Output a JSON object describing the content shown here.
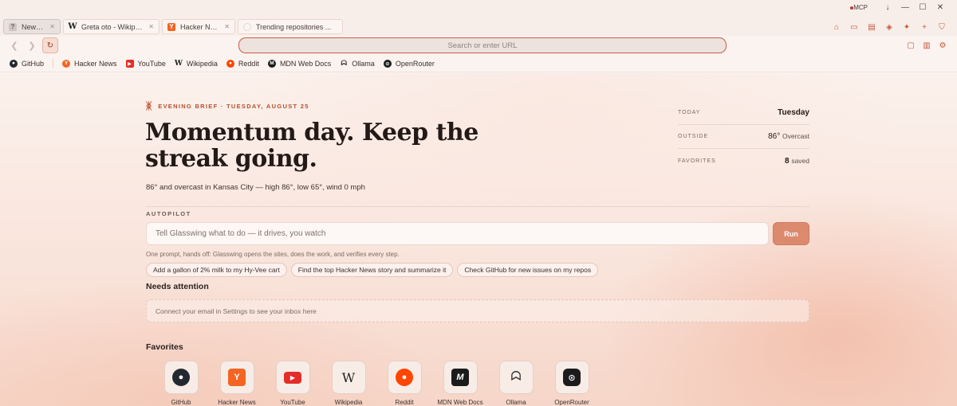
{
  "tabs": [
    {
      "title": "New Tab",
      "icon": "new-tab-icon",
      "active": true
    },
    {
      "title": "Greta oto - Wikipedia",
      "icon": "wikipedia-icon",
      "active": false
    },
    {
      "title": "Hacker News",
      "icon": "hacker-news-icon",
      "active": false
    },
    {
      "title": "Trending repositories ...",
      "icon": "github-icon",
      "active": false
    }
  ],
  "window": {
    "mcp_label": "MCP",
    "mcp_color": "#c0392b"
  },
  "urlbar": {
    "placeholder": "Search or enter URL"
  },
  "bookmarks": [
    {
      "label": "GitHub",
      "icon": "github-icon",
      "color": "#24292f"
    },
    {
      "label": "Hacker News",
      "icon": "hacker-news-icon",
      "color": "#f26522"
    },
    {
      "label": "YouTube",
      "icon": "youtube-icon",
      "color": "#e52d27"
    },
    {
      "label": "Wikipedia",
      "icon": "wikipedia-icon",
      "color": "#333333"
    },
    {
      "label": "Reddit",
      "icon": "reddit-icon",
      "color": "#ff4500"
    },
    {
      "label": "MDN Web Docs",
      "icon": "mdn-icon",
      "color": "#1b1b1b"
    },
    {
      "label": "Ollama",
      "icon": "ollama-icon",
      "color": "#333333"
    },
    {
      "label": "OpenRouter",
      "icon": "openrouter-icon",
      "color": "#1b1b1b"
    }
  ],
  "brief": {
    "label": "EVENING BRIEF · TUESDAY, AUGUST 25",
    "headline": "Momentum day. Keep the streak going.",
    "weather": "86° and overcast in Kansas City — high 86°, low 65°, wind 0 mph"
  },
  "stats": {
    "today_label": "TODAY",
    "today_value": "Tuesday",
    "outside_label": "OUTSIDE",
    "outside_temp": "86°",
    "outside_cond": "Overcast",
    "favorites_label": "FAVORITES",
    "favorites_count": "8",
    "favorites_suffix": "saved"
  },
  "autopilot": {
    "label": "AUTOPILOT",
    "placeholder": "Tell Glasswing what to do — it drives, you watch",
    "run_label": "Run",
    "hint": "One prompt, hands off: Glasswing opens the sites, does the work, and verifies every step.",
    "chips": [
      "Add a gallon of 2% milk to my Hy-Vee cart",
      "Find the top Hacker News story and summarize it",
      "Check GitHub for new issues on my repos"
    ]
  },
  "attention": {
    "title": "Needs attention",
    "empty_text": "Connect your email in Settings to see your inbox here"
  },
  "favorites": {
    "title": "Favorites",
    "items": [
      {
        "label": "GitHub",
        "icon": "github-icon"
      },
      {
        "label": "Hacker News",
        "icon": "hacker-news-icon"
      },
      {
        "label": "YouTube",
        "icon": "youtube-icon"
      },
      {
        "label": "Wikipedia",
        "icon": "wikipedia-icon"
      },
      {
        "label": "Reddit",
        "icon": "reddit-icon"
      },
      {
        "label": "MDN Web Docs",
        "icon": "mdn-icon"
      },
      {
        "label": "Ollama",
        "icon": "ollama-icon"
      },
      {
        "label": "OpenRouter",
        "icon": "openrouter-icon"
      }
    ]
  },
  "colors": {
    "accent": "#c25b3c",
    "run_button": "#dc8a6e",
    "url_border": "#d05a44"
  }
}
